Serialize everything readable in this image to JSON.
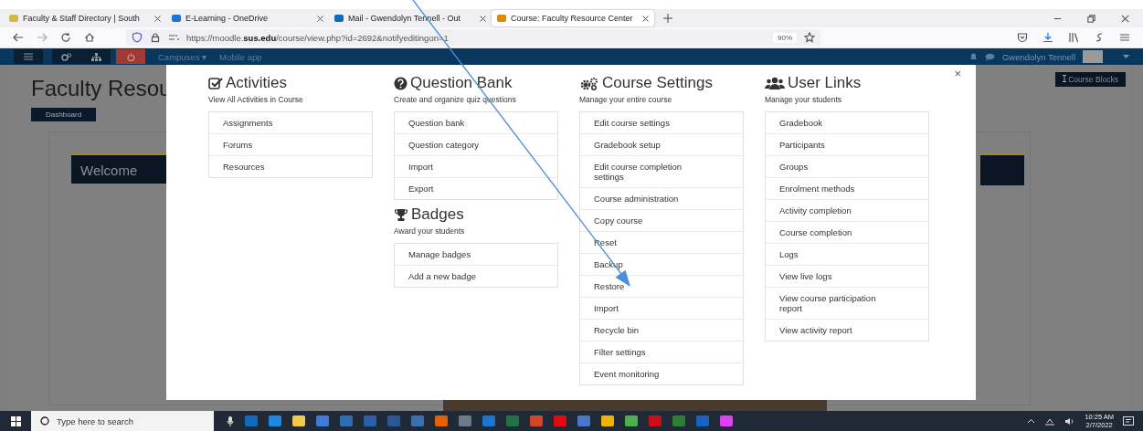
{
  "browser": {
    "tabs": [
      {
        "title": "Faculty & Staff Directory | South",
        "selected": false
      },
      {
        "title": "E-Learning - OneDrive",
        "selected": false
      },
      {
        "title": "Mail - Gwendolyn Tennell - Out",
        "selected": false
      },
      {
        "title": "Course: Faculty Resource Center",
        "selected": true
      }
    ],
    "url": "https://moodle.**sus.edu**/course/view.php?id=2692&notifyeditingon=1",
    "zoom": "90%"
  },
  "navbar": {
    "links": [
      "Campuses ▾",
      "Mobile app"
    ],
    "user": "Gwendolyn Tennell"
  },
  "page": {
    "title": "Faculty Resou",
    "dashboard_button": "Dashboard",
    "banner": "Welcome",
    "course_blocks_button": "Course Blocks"
  },
  "modal": {
    "columns": [
      {
        "sections": [
          {
            "title": "Activities",
            "subtitle": "View All Activities in Course",
            "items": [
              "Assignments",
              "Forums",
              "Resources"
            ]
          }
        ]
      },
      {
        "sections": [
          {
            "title": "Question Bank",
            "subtitle": "Create and organize quiz questions",
            "items": [
              "Question bank",
              "Question category",
              "Import",
              "Export"
            ]
          },
          {
            "title": "Badges",
            "subtitle": "Award your students",
            "items": [
              "Manage badges",
              "Add a new badge"
            ]
          }
        ]
      },
      {
        "sections": [
          {
            "title": "Course Settings",
            "subtitle": "Manage your entire course",
            "items": [
              "Edit course settings",
              "Gradebook setup",
              "Edit course completion settings",
              "Course administration",
              "Copy course",
              "Reset",
              "Backup",
              "Restore",
              "Import",
              "Recycle bin",
              "Filter settings",
              "Event monitoring"
            ]
          }
        ]
      },
      {
        "sections": [
          {
            "title": "User Links",
            "subtitle": "Manage your students",
            "items": [
              "Gradebook",
              "Participants",
              "Groups",
              "Enrolment methods",
              "Activity completion",
              "Course completion",
              "Logs",
              "View live logs",
              "View course participation report",
              "View activity report"
            ]
          }
        ]
      }
    ],
    "close": "×"
  },
  "taskbar": {
    "search_placeholder": "Type here to search",
    "time": "10:25 AM",
    "date": "2/7/2022"
  }
}
